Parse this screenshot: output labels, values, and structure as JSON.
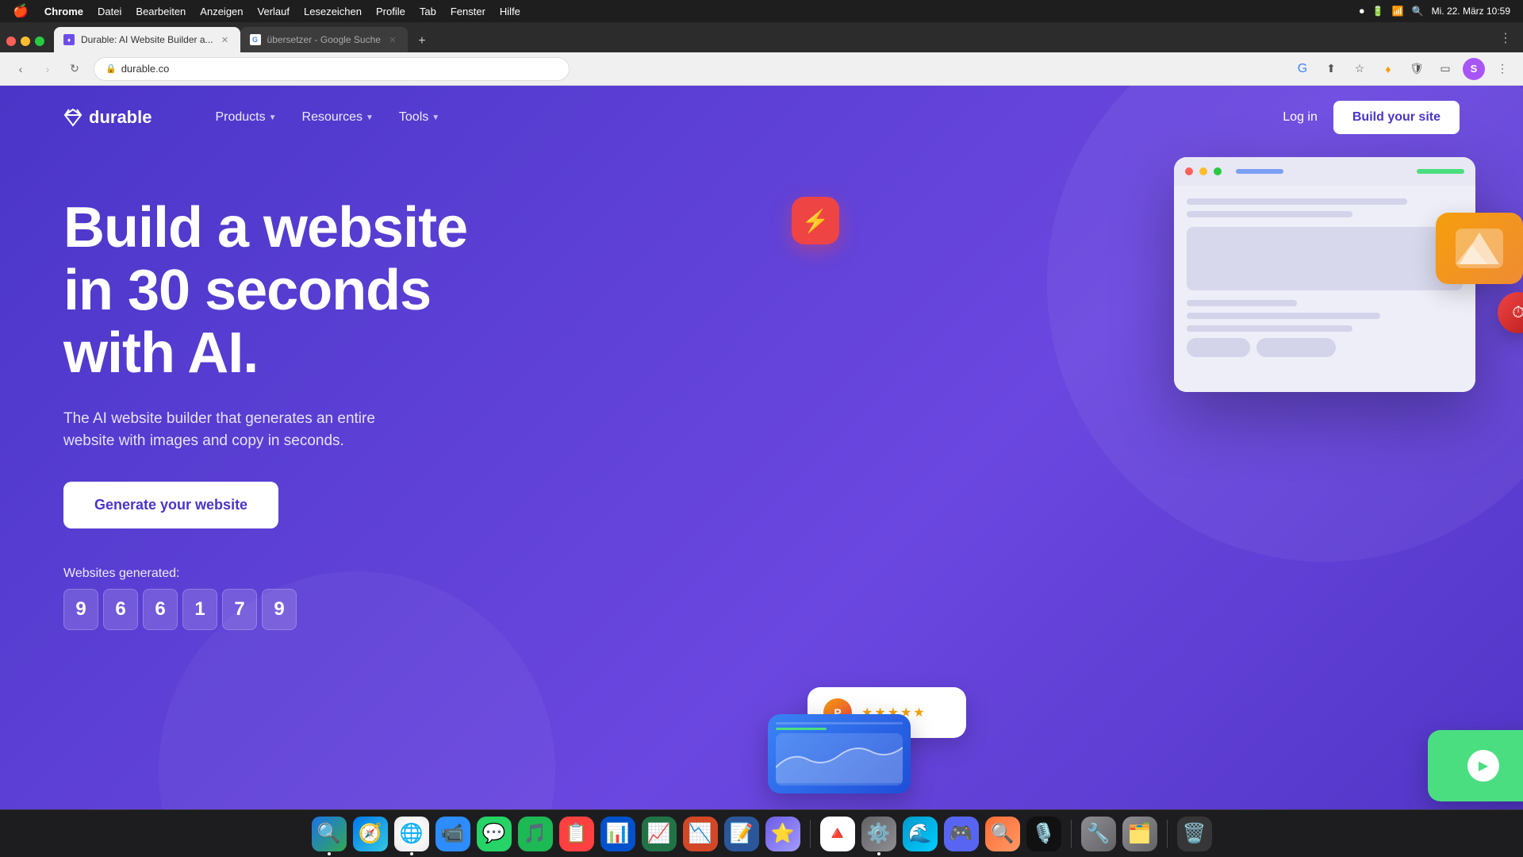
{
  "macos": {
    "menubar": {
      "apple": "🍎",
      "menus": [
        "Chrome",
        "Datei",
        "Bearbeiten",
        "Anzeigen",
        "Verlauf",
        "Lesezeichen",
        "Profile",
        "Tab",
        "Fenster",
        "Hilfe"
      ],
      "datetime": "Mi. 22. März  10:59"
    }
  },
  "browser": {
    "tabs": [
      {
        "id": "tab1",
        "label": "Durable: AI Website Builder a...",
        "favicon": "D",
        "active": true,
        "url": "durable.co"
      },
      {
        "id": "tab2",
        "label": "übersetzer - Google Suche",
        "favicon": "G",
        "active": false
      }
    ],
    "address": "durable.co"
  },
  "site": {
    "logo": "durable",
    "nav": {
      "products": "Products",
      "resources": "Resources",
      "tools": "Tools",
      "login": "Log in",
      "build": "Build your site"
    },
    "hero": {
      "title_line1": "Build a website",
      "title_line2": "in 30 seconds",
      "title_line3": "with AI.",
      "subtitle": "The AI website builder that generates an entire website with images and copy in seconds.",
      "cta": "Generate your website"
    },
    "counter": {
      "label": "Websites generated:",
      "digits": [
        "9",
        "6",
        "6",
        "1",
        "7",
        "9"
      ]
    },
    "review": {
      "stars": "★★★★★"
    }
  },
  "dock": {
    "apps": [
      {
        "name": "finder",
        "emoji": "🔍",
        "color": "#1a73e8",
        "dot": true
      },
      {
        "name": "safari",
        "emoji": "🧭",
        "color": "#0077ed",
        "dot": false
      },
      {
        "name": "chrome",
        "emoji": "🌐",
        "color": "#e8e8e8",
        "dot": true
      },
      {
        "name": "zoom",
        "emoji": "📹",
        "color": "#2D8CFF",
        "dot": false
      },
      {
        "name": "whatsapp",
        "emoji": "💬",
        "color": "#25D366",
        "dot": false
      },
      {
        "name": "spotify",
        "emoji": "🎵",
        "color": "#1DB954",
        "dot": false
      },
      {
        "name": "stack",
        "emoji": "📋",
        "color": "#FF4040",
        "dot": false
      },
      {
        "name": "trello",
        "emoji": "📊",
        "color": "#0052CC",
        "dot": false
      },
      {
        "name": "excel",
        "emoji": "📈",
        "color": "#217346",
        "dot": false
      },
      {
        "name": "powerpoint",
        "emoji": "📉",
        "color": "#D24726",
        "dot": false
      },
      {
        "name": "word",
        "emoji": "📝",
        "color": "#2B579A",
        "dot": false
      },
      {
        "name": "notchmeister",
        "emoji": "⭐",
        "color": "#6C5CE7",
        "dot": false
      },
      {
        "name": "google-drive",
        "emoji": "🔺",
        "color": "#1a73e8",
        "dot": false
      },
      {
        "name": "system-prefs",
        "emoji": "⚙️",
        "color": "#636366",
        "dot": false
      },
      {
        "name": "arc",
        "emoji": "🌊",
        "color": "#0099CC",
        "dot": false
      },
      {
        "name": "discord",
        "emoji": "🎮",
        "color": "#5865F2",
        "dot": false
      },
      {
        "name": "find-my",
        "emoji": "🔍",
        "color": "#FF6B35",
        "dot": false
      },
      {
        "name": "music",
        "emoji": "🎙️",
        "color": "#FF3A5C",
        "dot": false
      },
      {
        "name": "tools1",
        "emoji": "🔧",
        "color": "#8E8E93",
        "dot": false
      },
      {
        "name": "tools2",
        "emoji": "🗂️",
        "color": "#8E8E93",
        "dot": false
      },
      {
        "name": "trash",
        "emoji": "🗑️",
        "color": "#636366",
        "dot": false
      }
    ]
  }
}
